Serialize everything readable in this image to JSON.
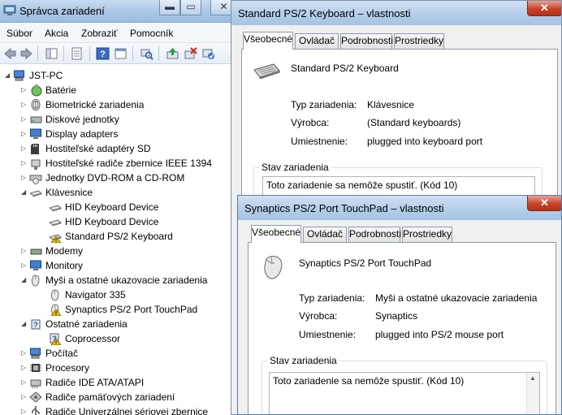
{
  "device_manager": {
    "title": "Správca zariadení",
    "caption_minimize": "▬",
    "caption_maximize": "▭",
    "caption_close": "✕",
    "menu": [
      "Súbor",
      "Akcia",
      "Zobraziť",
      "Pomocník"
    ],
    "root": "JST-PC",
    "tree": [
      {
        "label": "Batérie",
        "icon": "battery-icon",
        "expanded": false
      },
      {
        "label": "Biometrické zariadenia",
        "icon": "fingerprint-icon",
        "expanded": false
      },
      {
        "label": "Diskové jednotky",
        "icon": "disk-drive-icon",
        "expanded": false
      },
      {
        "label": "Display adapters",
        "icon": "display-adapter-icon",
        "expanded": false
      },
      {
        "label": "Hostiteľské adaptéry SD",
        "icon": "sd-host-icon",
        "expanded": false
      },
      {
        "label": "Hostiteľské radiče zbernice IEEE 1394",
        "icon": "ieee1394-icon",
        "expanded": false
      },
      {
        "label": "Jednotky DVD-ROM a CD-ROM",
        "icon": "dvd-drive-icon",
        "expanded": false
      },
      {
        "label": "Klávesnice",
        "icon": "keyboard-icon",
        "expanded": true
      },
      {
        "label": "HID Keyboard Device",
        "icon": "keyboard-icon",
        "child": true
      },
      {
        "label": "HID Keyboard Device",
        "icon": "keyboard-icon",
        "child": true
      },
      {
        "label": "Standard PS/2 Keyboard",
        "icon": "keyboard-warning-icon",
        "child": true
      },
      {
        "label": "Modemy",
        "icon": "modem-icon",
        "expanded": false
      },
      {
        "label": "Monitory",
        "icon": "monitor-icon",
        "expanded": false
      },
      {
        "label": "Myši a ostatné ukazovacie zariadenia",
        "icon": "mouse-icon",
        "expanded": true
      },
      {
        "label": "Navigator 335",
        "icon": "mouse-icon",
        "child": true
      },
      {
        "label": "Synaptics PS/2 Port TouchPad",
        "icon": "mouse-warning-icon",
        "child": true
      },
      {
        "label": "Ostatné zariadenia",
        "icon": "other-devices-icon",
        "expanded": true
      },
      {
        "label": "Coprocessor",
        "icon": "unknown-device-warning-icon",
        "child": true
      },
      {
        "label": "Počítač",
        "icon": "computer-icon",
        "expanded": false
      },
      {
        "label": "Procesory",
        "icon": "processor-icon",
        "expanded": false
      },
      {
        "label": "Radiče IDE ATA/ATAPI",
        "icon": "ide-controller-icon",
        "expanded": false
      },
      {
        "label": "Radiče pamäťových zariadení",
        "icon": "storage-controller-icon",
        "expanded": false
      },
      {
        "label": "Radiče Univerzálnej sériovej zbernice",
        "icon": "usb-controller-icon",
        "expanded": false
      }
    ]
  },
  "keyboard_dialog": {
    "title": "Standard PS/2 Keyboard – vlastnosti",
    "close": "✕",
    "tabs": [
      "Všeobecné",
      "Ovládač",
      "Podrobnosti",
      "Prostriedky"
    ],
    "device_name": "Standard PS/2 Keyboard",
    "props": [
      {
        "key": "Typ zariadenia:",
        "value": "Klávesnice"
      },
      {
        "key": "Výrobca:",
        "value": "(Standard keyboards)"
      },
      {
        "key": "Umiestnenie:",
        "value": "plugged into keyboard port"
      }
    ],
    "status_legend": "Stav zariadenia",
    "status_text": "Toto zariadenie sa nemôže spustiť. (Kód 10)"
  },
  "touchpad_dialog": {
    "title": "Synaptics PS/2 Port TouchPad – vlastnosti",
    "close": "✕",
    "tabs": [
      "Všeobecné",
      "Ovládač",
      "Podrobnosti",
      "Prostriedky"
    ],
    "device_name": "Synaptics PS/2 Port TouchPad",
    "props": [
      {
        "key": "Typ zariadenia:",
        "value": "Myši a ostatné ukazovacie zariadenia"
      },
      {
        "key": "Výrobca:",
        "value": "Synaptics"
      },
      {
        "key": "Umiestnenie:",
        "value": "plugged into PS/2 mouse port"
      }
    ],
    "status_legend": "Stav zariadenia",
    "status_text": "Toto zariadenie sa nemôže spustiť. (Kód 10)"
  }
}
